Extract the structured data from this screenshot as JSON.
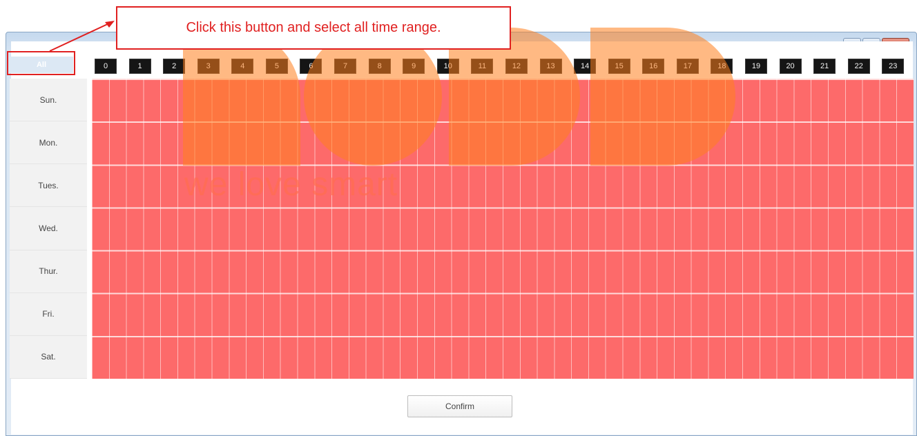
{
  "annotation": {
    "callout_text": "Click this button and select all time range."
  },
  "window": {
    "close_symbol": "✕",
    "maximize_symbol": "□",
    "minimize_symbol": "—"
  },
  "select_all": {
    "label": "All"
  },
  "hours": [
    "0",
    "1",
    "2",
    "3",
    "4",
    "5",
    "6",
    "7",
    "8",
    "9",
    "10",
    "11",
    "12",
    "13",
    "14",
    "15",
    "16",
    "17",
    "18",
    "19",
    "20",
    "21",
    "22",
    "23"
  ],
  "days": [
    "Sun.",
    "Mon.",
    "Tues.",
    "Wed.",
    "Thur.",
    "Fri.",
    "Sat."
  ],
  "grid": {
    "fill_color": "#fd6a6a",
    "selected_fraction": 1.0
  },
  "watermark": {
    "text": "we love smart"
  },
  "confirm": {
    "label": "Confirm"
  },
  "colors": {
    "annotation": "#e02020",
    "header_bg": "#151515",
    "cell_selected": "#fd6a6a"
  }
}
